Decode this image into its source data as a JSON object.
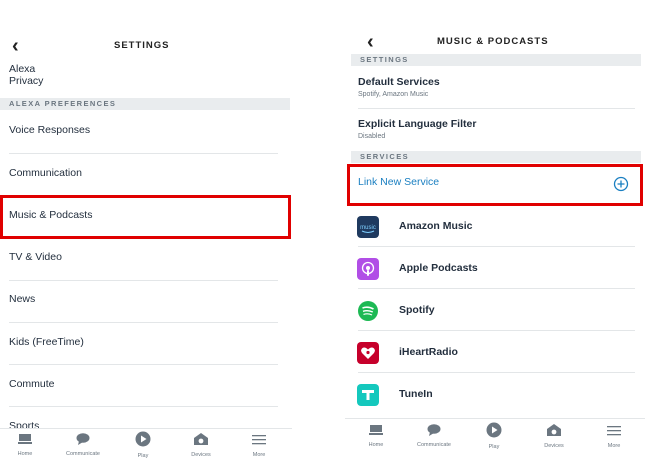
{
  "left": {
    "title": "SETTINGS",
    "back_icon": "chevron-left-icon",
    "top_item": "Alexa Privacy",
    "section": "ALEXA PREFERENCES",
    "items": [
      "Voice Responses",
      "Communication",
      "Music & Podcasts",
      "TV & Video",
      "News",
      "Kids (FreeTime)",
      "Commute",
      "Sports"
    ],
    "tabs": [
      {
        "label": "Home",
        "icon": "home-icon"
      },
      {
        "label": "Communicate",
        "icon": "chat-bubble-icon"
      },
      {
        "label": "Play",
        "icon": "play-icon"
      },
      {
        "label": "Devices",
        "icon": "devices-icon"
      },
      {
        "label": "More",
        "icon": "menu-icon"
      }
    ]
  },
  "right": {
    "title": "MUSIC & PODCASTS",
    "back_icon": "chevron-left-icon",
    "section_settings": "SETTINGS",
    "default_services": {
      "label": "Default Services",
      "sub": "Spotify, Amazon Music"
    },
    "explicit_filter": {
      "label": "Explicit Language Filter",
      "sub": "Disabled"
    },
    "section_services": "SERVICES",
    "link_new": "Link New Service",
    "services": [
      {
        "name": "Amazon Music",
        "icon": "amazon-music-icon",
        "color": "#232f3e"
      },
      {
        "name": "Apple Podcasts",
        "icon": "apple-podcasts-icon",
        "color": "#a855f7"
      },
      {
        "name": "Spotify",
        "icon": "spotify-icon",
        "color": "#1db954"
      },
      {
        "name": "iHeartRadio",
        "icon": "iheartradio-icon",
        "color": "#c6002b"
      },
      {
        "name": "TuneIn",
        "icon": "tunein-icon",
        "color": "#14d8cc"
      }
    ],
    "tabs": [
      {
        "label": "Home",
        "icon": "home-icon"
      },
      {
        "label": "Communicate",
        "icon": "chat-bubble-icon"
      },
      {
        "label": "Play",
        "icon": "play-icon"
      },
      {
        "label": "Devices",
        "icon": "devices-icon"
      },
      {
        "label": "More",
        "icon": "menu-icon"
      }
    ]
  },
  "colors": {
    "highlight": "#e00000",
    "link": "#1a7fc1",
    "section_bg": "#e9ecee"
  }
}
